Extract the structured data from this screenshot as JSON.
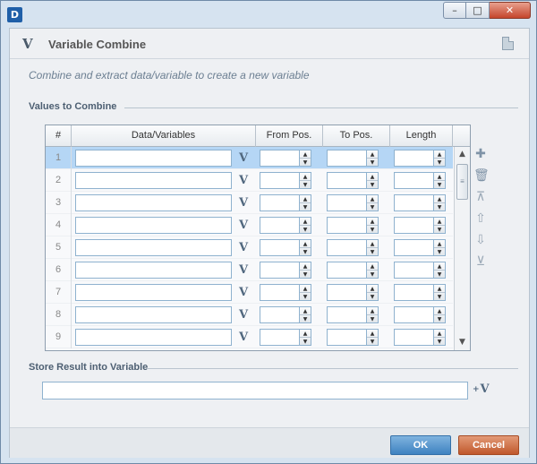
{
  "window": {
    "app_icon": "D"
  },
  "dialog": {
    "logo": "V",
    "title": "Variable Combine",
    "description": "Combine and extract data/variable to create a new variable"
  },
  "values_section": {
    "label": "Values to Combine",
    "columns": [
      "#",
      "Data/Variables",
      "From Pos.",
      "To Pos.",
      "Length"
    ],
    "rows": [
      {
        "num": "1",
        "selected": true
      },
      {
        "num": "2"
      },
      {
        "num": "3"
      },
      {
        "num": "4"
      },
      {
        "num": "5"
      },
      {
        "num": "6"
      },
      {
        "num": "7"
      },
      {
        "num": "8"
      },
      {
        "num": "9"
      }
    ],
    "row_button_label": "V"
  },
  "store_section": {
    "label": "Store Result into Variable",
    "value": "",
    "button_label": "V"
  },
  "footer": {
    "ok_label": "OK",
    "cancel_label": "Cancel"
  },
  "colors": {
    "selected_row": "#b5d6f5",
    "ok_button": "#3e82c0",
    "cancel_button": "#c0582c"
  },
  "icons": {
    "side_tools": [
      "add-icon",
      "delete-icon",
      "move-top-icon",
      "move-up-icon",
      "move-down-icon",
      "move-bottom-icon"
    ]
  }
}
